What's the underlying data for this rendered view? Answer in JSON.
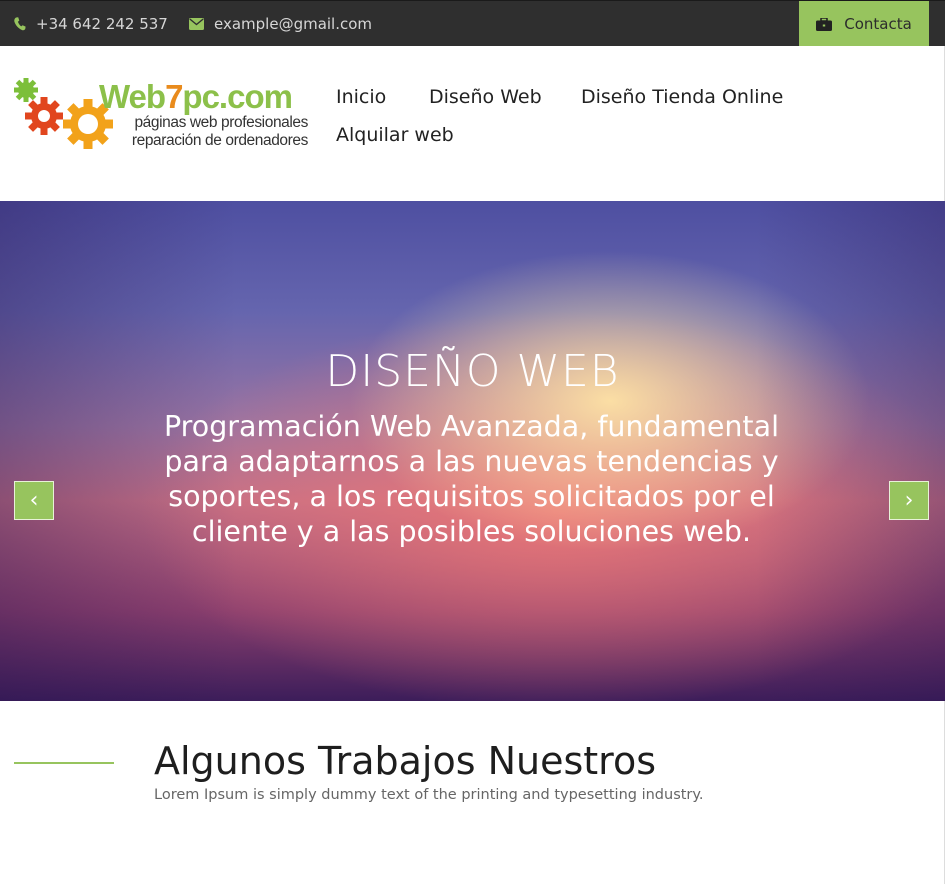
{
  "topbar": {
    "phone": "+34 642 242 537",
    "email": "example@gmail.com",
    "contact_label": "Contacta",
    "icons": [
      "phone-icon",
      "envelope-icon",
      "briefcase-icon"
    ],
    "accent_color": "#97c45e"
  },
  "logo": {
    "title_a": "Web",
    "title_b": "7",
    "title_c": "pc.com",
    "line1": "páginas web profesionales",
    "line2": "reparación de ordenadores"
  },
  "nav": {
    "items": [
      {
        "label": "Inicio"
      },
      {
        "label": "Diseño Web"
      },
      {
        "label": "Diseño Tienda Online"
      },
      {
        "label": "Alquilar web"
      }
    ]
  },
  "hero": {
    "title": "DISEÑO WEB",
    "text": "Programación Web Avanzada, fundamental para adaptarnos a las nuevas tendencias y soportes, a los requisitos solicitados por el cliente y a las posibles soluciones web.",
    "prev_label": "‹",
    "next_label": "›"
  },
  "section": {
    "title": "Algunos Trabajos Nuestros",
    "subtitle": "Lorem Ipsum is simply dummy text of the printing and typesetting industry."
  }
}
